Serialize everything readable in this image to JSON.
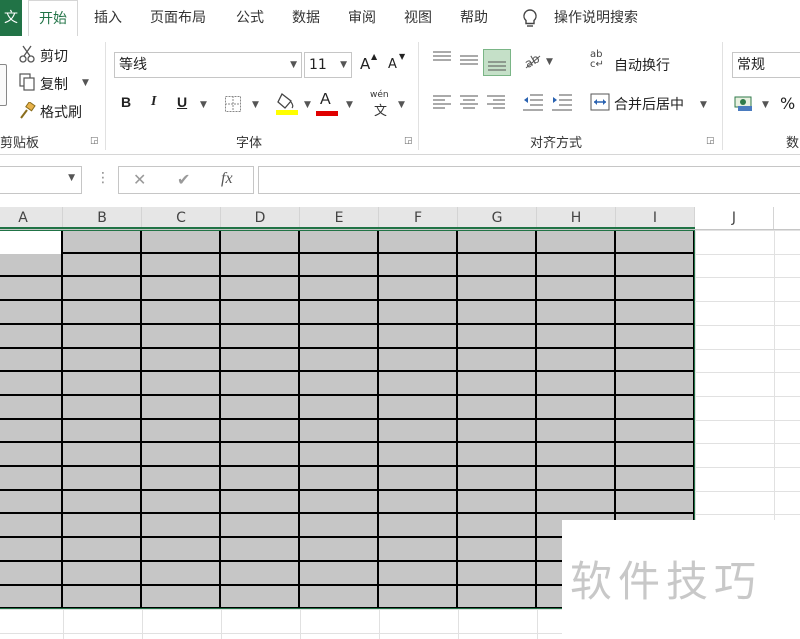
{
  "tabs": {
    "file": "文",
    "home": "开始",
    "insert": "插入",
    "page_layout": "页面布局",
    "formulas": "公式",
    "data": "数据",
    "review": "审阅",
    "view": "视图",
    "help": "帮助",
    "tell_me": "操作说明搜索"
  },
  "clipboard": {
    "cut": "剪切",
    "copy": "复制",
    "format_painter": "格式刷",
    "group_label": "剪贴板"
  },
  "font": {
    "name": "等线",
    "size": "11",
    "grow": "A",
    "shrink": "A",
    "bold": "B",
    "italic": "I",
    "underline": "U",
    "font_color": "A",
    "phonetic_top": "wén",
    "phonetic_bottom": "文",
    "group_label": "字体"
  },
  "alignment": {
    "wrap_text": "自动换行",
    "merge_center": "合并后居中",
    "wrap_icon_top": "ab",
    "wrap_icon_bottom": "c↵",
    "group_label": "对齐方式"
  },
  "number": {
    "format": "常规",
    "percent": "%",
    "group_label": "数"
  },
  "formula_bar": {
    "fx": "fx",
    "cancel": "✕",
    "enter": "✔",
    "options": "⋮"
  },
  "columns": [
    "A",
    "B",
    "C",
    "D",
    "E",
    "F",
    "G",
    "H",
    "I",
    "J"
  ],
  "watermark": "软件技巧",
  "colors": {
    "accent": "#217346",
    "selection_fill": "#c6c6c6",
    "header_selected": "#e6e6e6",
    "highlight_yellow": "#ffff00",
    "font_red": "#e00000"
  }
}
